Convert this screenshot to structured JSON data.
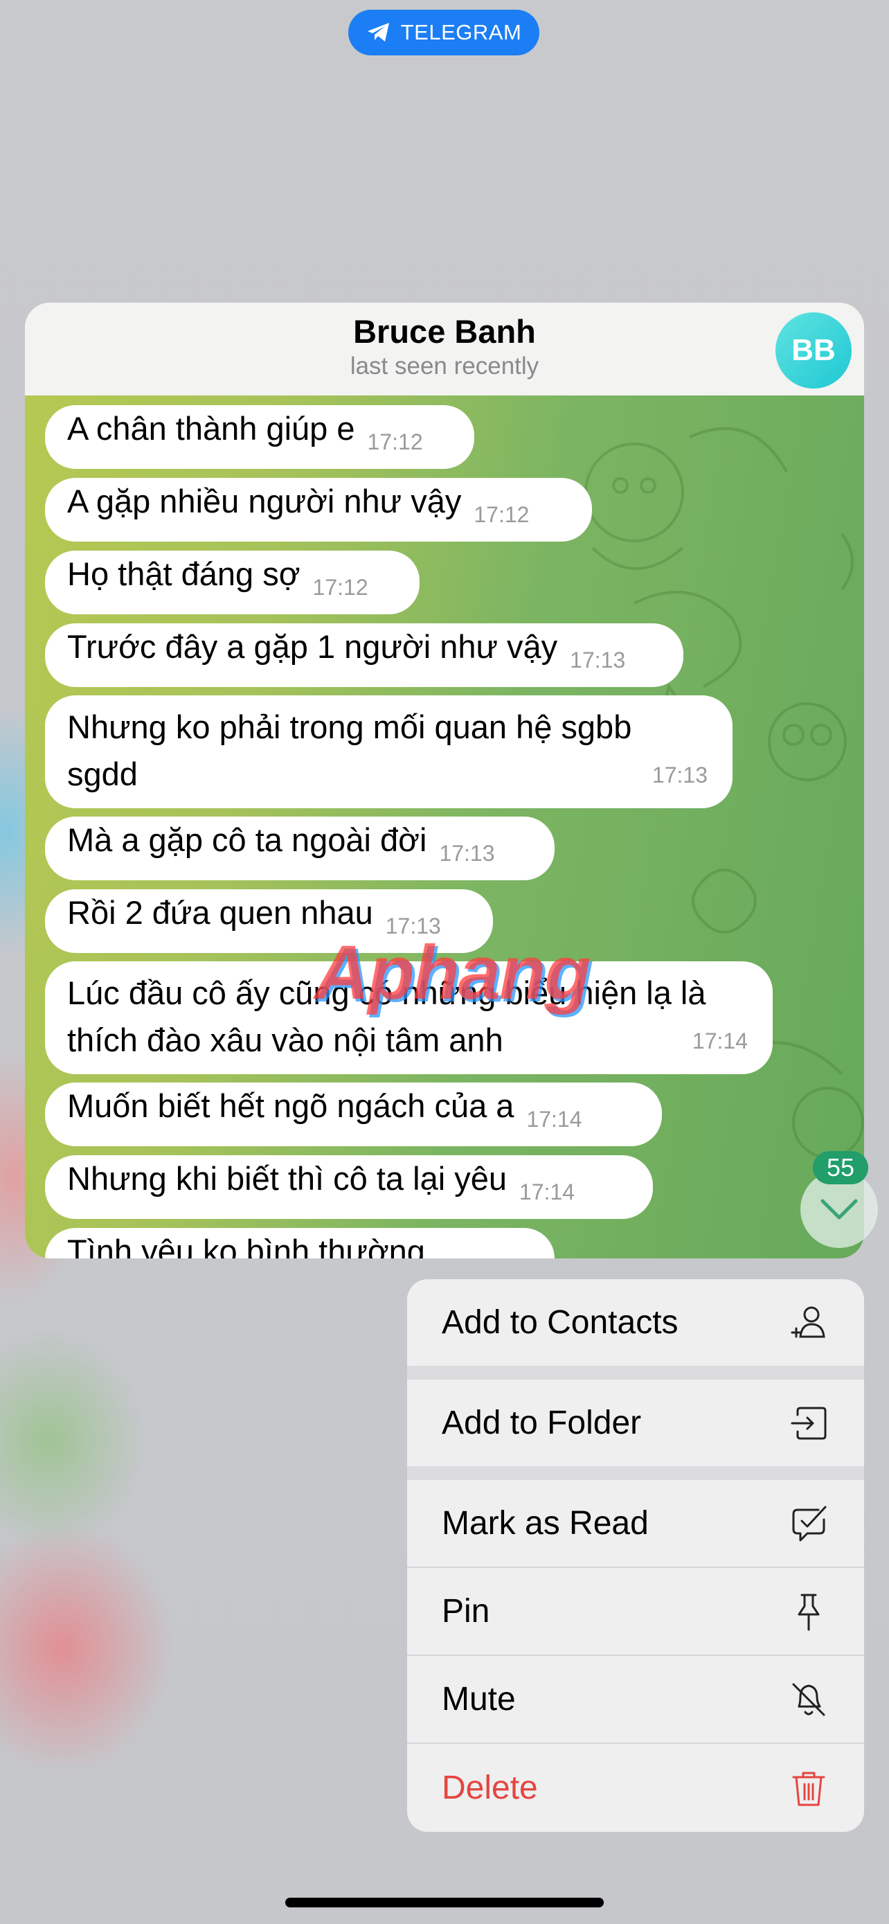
{
  "app": {
    "name": "TELEGRAM",
    "icon": "telegram-plane-icon",
    "accent": "#1c7ef4"
  },
  "chat": {
    "contact_name": "Bruce Banh",
    "status": "last seen recently",
    "avatar_initials": "BB",
    "messages": [
      {
        "text": "A chân thành giúp e",
        "time": "17:12"
      },
      {
        "text": "A gặp nhiều người như vậy",
        "time": "17:12"
      },
      {
        "text": "Họ thật đáng sợ",
        "time": "17:12"
      },
      {
        "text": "Trước đây a gặp 1 người như vậy",
        "time": "17:13"
      },
      {
        "text": "Nhưng ko phải trong mối quan hệ sgbb sgdd",
        "time": "17:13"
      },
      {
        "text": "Mà a gặp cô ta ngoài đời",
        "time": "17:13"
      },
      {
        "text": "Rồi 2 đứa quen nhau",
        "time": "17:13"
      },
      {
        "text": "Lúc đầu cô ấy cũng có những biểu hiện lạ là thích đào xâu vào nội tâm anh",
        "time": "17:14"
      },
      {
        "text": "Muốn biết hết ngõ ngách của a",
        "time": "17:14"
      },
      {
        "text": "Nhưng khi biết thì cô ta lại yêu",
        "time": "17:14"
      },
      {
        "text": "Tình yêu ko bình thường",
        "time": ""
      }
    ],
    "unread_count": "55",
    "watermark": "Aphang"
  },
  "menu": {
    "items": [
      {
        "label": "Add to Contacts",
        "icon": "add-contact-icon"
      },
      {
        "label": "Add to Folder",
        "icon": "add-to-folder-icon"
      },
      {
        "label": "Mark as Read",
        "icon": "mark-read-icon"
      },
      {
        "label": "Pin",
        "icon": "pin-icon"
      },
      {
        "label": "Mute",
        "icon": "mute-bell-icon"
      },
      {
        "label": "Delete",
        "icon": "trash-icon",
        "color": "#e5453f"
      }
    ]
  }
}
